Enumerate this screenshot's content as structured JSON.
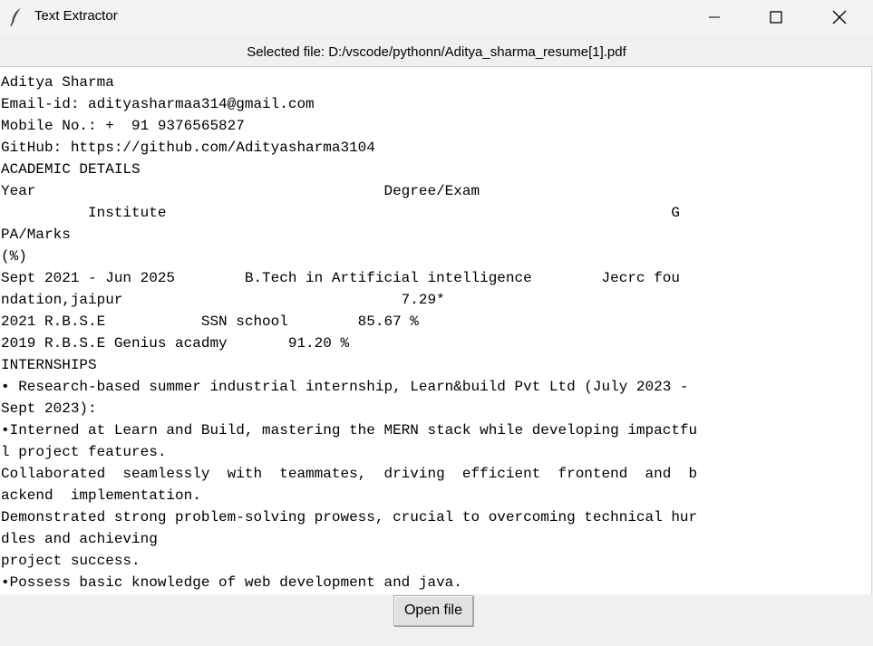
{
  "window": {
    "title": "Text Extractor",
    "icon": "feather-icon"
  },
  "file_label": "Selected file: D:/vscode/pythonn/Aditya_sharma_resume[1].pdf",
  "text_lines": [
    "Aditya Sharma",
    "Email-id: adityasharmaa314@gmail.com",
    "Mobile No.: +  91 9376565827",
    "GitHub: https://github.com/Adityasharma3104",
    "ACADEMIC DETAILS",
    "Year                                        Degree/Exam",
    "          Institute                                                          G",
    "PA/Marks",
    "(%)",
    "Sept 2021 - Jun 2025        B.Tech in Artificial intelligence        Jecrc fou",
    "ndation,jaipur                                7.29*",
    "2021 R.B.S.E           SSN school        85.67 %",
    "2019 R.B.S.E Genius acadmy       91.20 %",
    "INTERNSHIPS",
    "• Research-based summer industrial internship, Learn&build Pvt Ltd (July 2023 -",
    "Sept 2023):",
    "•Interned at Learn and Build, mastering the MERN stack while developing impactfu",
    "l project features.",
    "Collaborated  seamlessly  with  teammates,  driving  efficient  frontend  and  b",
    "ackend  implementation.",
    "Demonstrated strong problem-solving prowess, crucial to overcoming technical hur",
    "dles and achieving",
    "project success.",
    "•Possess basic knowledge of web development and java."
  ],
  "open_button": "Open file"
}
